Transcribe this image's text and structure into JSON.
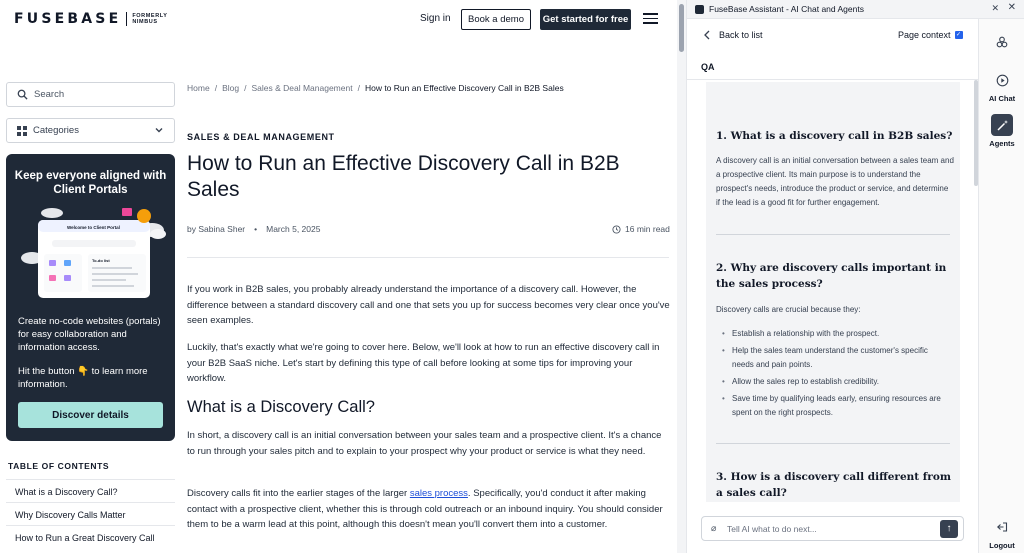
{
  "site": {
    "logo": {
      "word": "FUSEBASE",
      "formerly": "FORMERLY",
      "nimbus": "NIMBUS"
    },
    "nav": {
      "signin": "Sign in",
      "demo": "Book a demo",
      "start": "Get started for free"
    },
    "sidebar": {
      "search_placeholder": "Search",
      "categories": "Categories",
      "promo": {
        "title": "Keep everyone aligned with Client Portals",
        "illus_welcome": "Welcome to Client Portal",
        "illus_todo": "To-do list",
        "text1": "Create no-code websites (portals) for easy collaboration and information access.",
        "text2": "Hit the button 👇 to learn more information.",
        "button": "Discover details"
      },
      "toc_title": "TABLE OF CONTENTS",
      "toc": [
        {
          "label": "What is a Discovery Call?"
        },
        {
          "label": "Why Discovery Calls Matter"
        },
        {
          "label": "How to Run a Great Discovery Call"
        }
      ]
    },
    "article": {
      "breadcrumbs": [
        "Home",
        "/",
        "Blog",
        "/",
        "Sales & Deal Management",
        "/"
      ],
      "breadcrumb_current": "How to Run an Effective Discovery Call in B2B Sales",
      "kicker": "SALES & DEAL MANAGEMENT",
      "title": "How to Run an Effective Discovery Call in B2B Sales",
      "author": "by Sabina Sher",
      "bullet": "•",
      "date": "March 5, 2025",
      "read_time": "16 min read",
      "p1": "If you work in B2B sales, you probably already understand the importance of a discovery call. However, the difference between a standard discovery call and one that sets you up for success becomes very clear once you've seen examples.",
      "p2": "Luckily, that's exactly what we're going to cover here. Below, we'll look at how to run an effective discovery call in your B2B SaaS niche. Let's start by defining this type of call before looking at some tips for improving your workflow.",
      "h2": "What is a Discovery Call?",
      "p3": "In short, a discovery call is an initial conversation between your sales team and a prospective client. It's a chance to run through your sales pitch and to explain to your prospect why your product or service is what they need.",
      "p4_before": "Discovery calls fit into the earlier stages of the larger ",
      "p4_link": "sales process",
      "p4_after": ". Specifically, you'd conduct it after making contact with a prospective client, whether this is through cold outreach or an inbound inquiry. You should consider them to be a warm lead at this point, although this doesn't mean you'll convert them into a customer."
    }
  },
  "assistant": {
    "window_title": "FuseBase Assistant - AI Chat and Agents",
    "back": "Back to list",
    "page_context": "Page context",
    "page_context_checked": true,
    "section_label": "QA",
    "qa": [
      {
        "q": "1. What is a discovery call in B2B sales?",
        "a": "A discovery call is an initial conversation between a sales team and a prospective client. Its main purpose is to understand the prospect's needs, introduce the product or service, and determine if the lead is a good fit for further engagement."
      },
      {
        "q": "2. Why are discovery calls important in the sales process?",
        "a": "Discovery calls are crucial because they:",
        "bullets": [
          "Establish a relationship with the prospect.",
          "Help the sales team understand the customer's specific needs and pain points.",
          "Allow the sales rep to establish credibility.",
          "Save time by qualifying leads early, ensuring resources are spent on the right prospects."
        ]
      },
      {
        "q": "3. How is a discovery call different from a sales call?"
      }
    ],
    "input_placeholder": "Tell AI what to do next...",
    "rail": {
      "ai_chat": "AI Chat",
      "agents": "Agents",
      "logout": "Logout"
    }
  }
}
